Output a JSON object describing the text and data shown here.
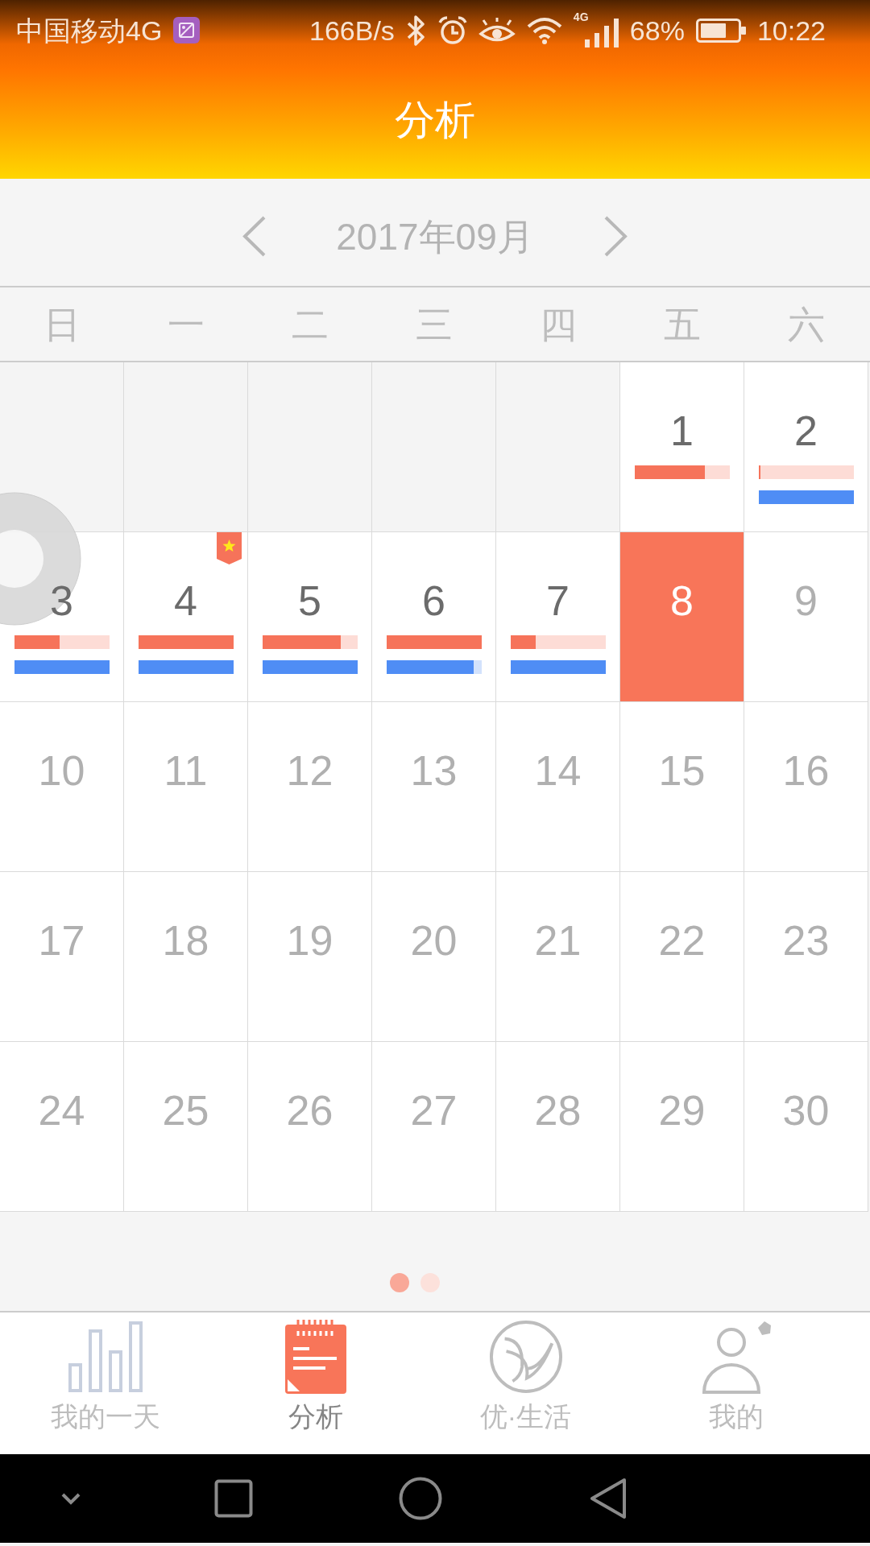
{
  "status_bar": {
    "carrier": "中国移动4G",
    "net_speed": "166B/s",
    "network": "4G",
    "battery": "68%",
    "time": "10:22"
  },
  "header": {
    "title": "分析"
  },
  "month_nav": {
    "label": "2017年09月"
  },
  "weekdays": [
    "日",
    "一",
    "二",
    "三",
    "四",
    "五",
    "六"
  ],
  "calendar": {
    "cells": [
      {
        "kind": "blank"
      },
      {
        "kind": "blank"
      },
      {
        "kind": "blank"
      },
      {
        "kind": "blank"
      },
      {
        "kind": "blank"
      },
      {
        "kind": "day",
        "day": "1",
        "dimmed": false,
        "selected": false,
        "starred": false,
        "meters": [
          {
            "color": "#f6735a",
            "level": 0.74
          }
        ]
      },
      {
        "kind": "day",
        "day": "2",
        "dimmed": false,
        "selected": false,
        "starred": false,
        "meters": [
          {
            "color": "#f6735a",
            "level": 0.02
          },
          {
            "color": "#4f8df5",
            "level": 1
          }
        ]
      },
      {
        "kind": "day",
        "day": "3",
        "dimmed": false,
        "selected": false,
        "starred": false,
        "meters": [
          {
            "color": "#f6735a",
            "level": 0.48
          },
          {
            "color": "#4f8df5",
            "level": 1
          }
        ]
      },
      {
        "kind": "day",
        "day": "4",
        "dimmed": false,
        "selected": false,
        "starred": true,
        "meters": [
          {
            "color": "#f6735a",
            "level": 1
          },
          {
            "color": "#4f8df5",
            "level": 1
          }
        ]
      },
      {
        "kind": "day",
        "day": "5",
        "dimmed": false,
        "selected": false,
        "starred": false,
        "meters": [
          {
            "color": "#f6735a",
            "level": 0.83
          },
          {
            "color": "#4f8df5",
            "level": 1
          }
        ]
      },
      {
        "kind": "day",
        "day": "6",
        "dimmed": false,
        "selected": false,
        "starred": false,
        "meters": [
          {
            "color": "#f6735a",
            "level": 1
          },
          {
            "color": "#4f8df5",
            "level": 0.92
          }
        ]
      },
      {
        "kind": "day",
        "day": "7",
        "dimmed": false,
        "selected": false,
        "starred": false,
        "meters": [
          {
            "color": "#f6735a",
            "level": 0.27
          },
          {
            "color": "#4f8df5",
            "level": 1
          }
        ]
      },
      {
        "kind": "day",
        "day": "8",
        "dimmed": false,
        "selected": true,
        "starred": false
      },
      {
        "kind": "day",
        "day": "9",
        "dimmed": true,
        "selected": false,
        "starred": false
      },
      {
        "kind": "day",
        "day": "10",
        "dimmed": true,
        "selected": false,
        "starred": false
      },
      {
        "kind": "day",
        "day": "11",
        "dimmed": true,
        "selected": false,
        "starred": false
      },
      {
        "kind": "day",
        "day": "12",
        "dimmed": true,
        "selected": false,
        "starred": false
      },
      {
        "kind": "day",
        "day": "13",
        "dimmed": true,
        "selected": false,
        "starred": false
      },
      {
        "kind": "day",
        "day": "14",
        "dimmed": true,
        "selected": false,
        "starred": false
      },
      {
        "kind": "day",
        "day": "15",
        "dimmed": true,
        "selected": false,
        "starred": false
      },
      {
        "kind": "day",
        "day": "16",
        "dimmed": true,
        "selected": false,
        "starred": false
      },
      {
        "kind": "day",
        "day": "17",
        "dimmed": true,
        "selected": false,
        "starred": false
      },
      {
        "kind": "day",
        "day": "18",
        "dimmed": true,
        "selected": false,
        "starred": false
      },
      {
        "kind": "day",
        "day": "19",
        "dimmed": true,
        "selected": false,
        "starred": false
      },
      {
        "kind": "day",
        "day": "20",
        "dimmed": true,
        "selected": false,
        "starred": false
      },
      {
        "kind": "day",
        "day": "21",
        "dimmed": true,
        "selected": false,
        "starred": false
      },
      {
        "kind": "day",
        "day": "22",
        "dimmed": true,
        "selected": false,
        "starred": false
      },
      {
        "kind": "day",
        "day": "23",
        "dimmed": true,
        "selected": false,
        "starred": false
      },
      {
        "kind": "day",
        "day": "24",
        "dimmed": true,
        "selected": false,
        "starred": false
      },
      {
        "kind": "day",
        "day": "25",
        "dimmed": true,
        "selected": false,
        "starred": false
      },
      {
        "kind": "day",
        "day": "26",
        "dimmed": true,
        "selected": false,
        "starred": false
      },
      {
        "kind": "day",
        "day": "27",
        "dimmed": true,
        "selected": false,
        "starred": false
      },
      {
        "kind": "day",
        "day": "28",
        "dimmed": true,
        "selected": false,
        "starred": false
      },
      {
        "kind": "day",
        "day": "29",
        "dimmed": true,
        "selected": false,
        "starred": false
      },
      {
        "kind": "day",
        "day": "30",
        "dimmed": true,
        "selected": false,
        "starred": false
      }
    ]
  },
  "pager": [
    {
      "selected": true
    },
    {
      "selected": false
    }
  ],
  "tabs": [
    {
      "label": "我的一天",
      "selected": false
    },
    {
      "label": "分析",
      "selected": true
    },
    {
      "label": "优·生活",
      "selected": false
    },
    {
      "label": "我的",
      "selected": false
    }
  ]
}
